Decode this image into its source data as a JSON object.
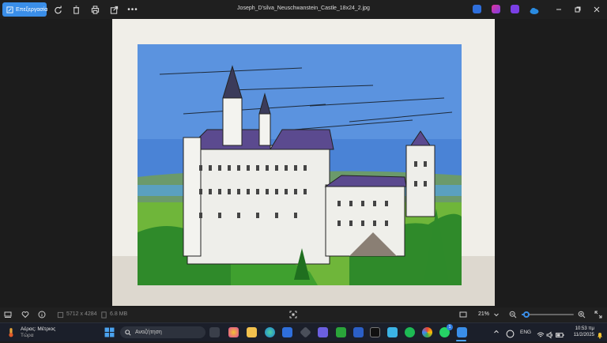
{
  "toolbar": {
    "edit_label": "Επεξεργασία",
    "title": "Joseph_D'silva_Neuschwanstein_Castle_18x24_2.jpg"
  },
  "status": {
    "dimensions": "5712 x 4284",
    "filesize": "6.8 MB",
    "zoom": "21%",
    "zoom_level": 0.21
  },
  "taskbar": {
    "weather_title": "Αέρας: Μέτριος",
    "weather_sub": "Τώρα",
    "search_placeholder": "Αναζήτηση",
    "language": "ENG",
    "time": "10:53 πμ",
    "date": "11/2/2025",
    "chat_badge": "1"
  },
  "colors": {
    "accent": "#3a8ee8",
    "titlebar": "#1f1f1f",
    "taskbar": "#1b1f2a"
  }
}
